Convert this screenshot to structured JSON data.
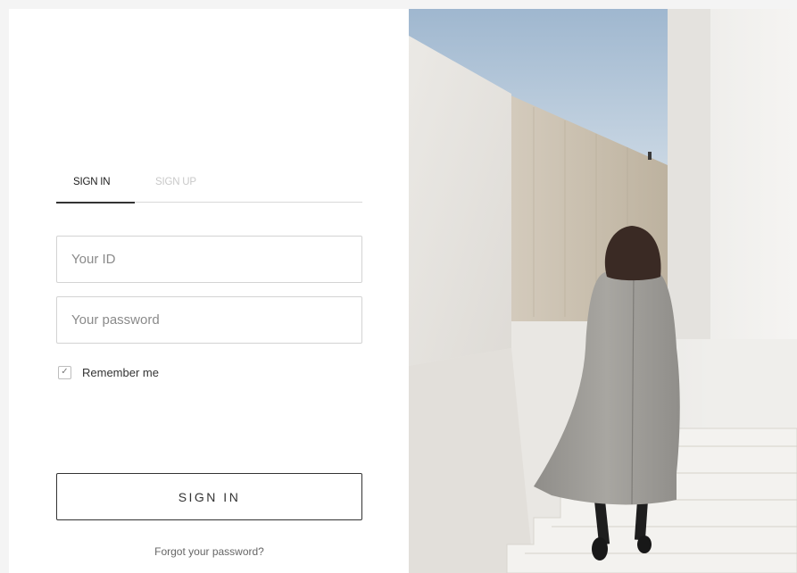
{
  "tabs": [
    {
      "label": "SIGN IN",
      "active": true
    },
    {
      "label": "SIGN UP",
      "active": false
    }
  ],
  "form": {
    "id_placeholder": "Your ID",
    "id_value": "",
    "password_placeholder": "Your password",
    "password_value": "",
    "remember_label": "Remember me",
    "remember_checked": true,
    "checkbox_mark": "✓",
    "submit_label": "SIGN IN",
    "forgot_label": "Forgot your password?"
  },
  "photo": {
    "icon": "photo-woman-on-stairs"
  },
  "colors": {
    "accent": "#333333",
    "muted_tab": "#c9c9c9",
    "border": "#d3d3d3",
    "background": "#f4f4f4"
  }
}
